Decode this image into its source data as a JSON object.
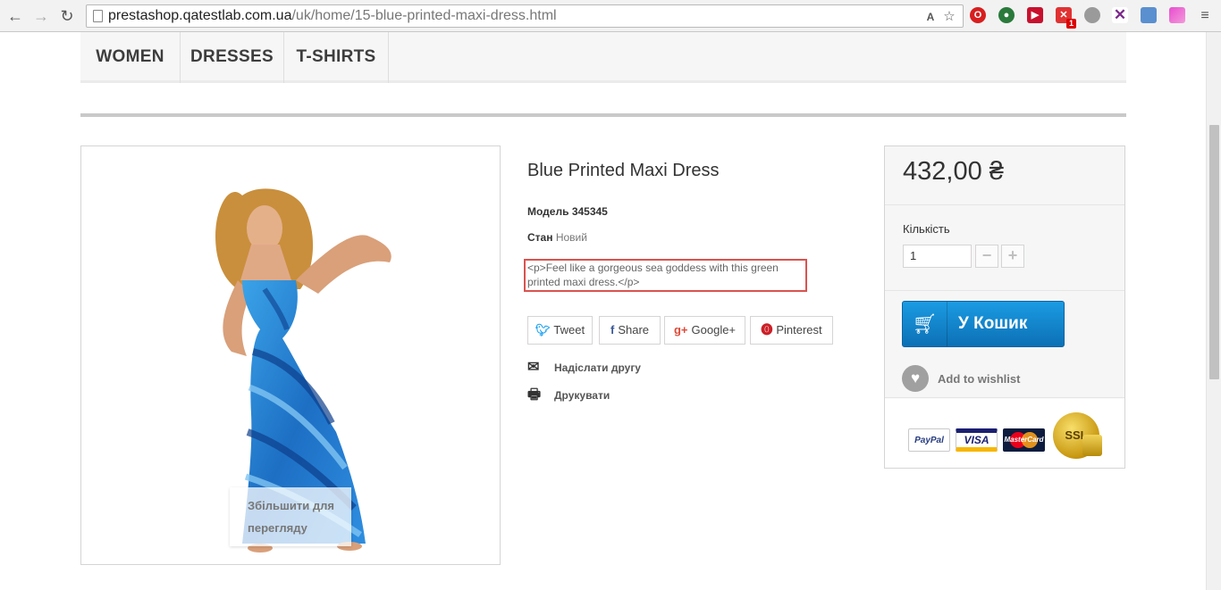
{
  "browser": {
    "url_host": "prestashop.qatestlab.com.ua",
    "url_path": "/uk/home/15-blue-printed-maxi-dress.html",
    "ext_badge": "1"
  },
  "menu": {
    "items": [
      "WOMEN",
      "DRESSES",
      "T-SHIRTS"
    ]
  },
  "image": {
    "zoom_hint_line1": "Збільшити для",
    "zoom_hint_line2": "перегляду"
  },
  "product": {
    "title": "Blue Printed Maxi Dress",
    "model_label": "Модель",
    "model_value": "345345",
    "condition_label": "Стан",
    "condition_value": "Новий",
    "description": "<p>Feel like a gorgeous sea goddess with this green printed maxi dress.</p>"
  },
  "share": {
    "tweet": "Tweet",
    "share": "Share",
    "google": "Google+",
    "pinterest": "Pinterest"
  },
  "actions": {
    "send_friend": "Надіслати другу",
    "print": "Друкувати"
  },
  "buy": {
    "price": "432,00 ₴",
    "qty_label": "Кількість",
    "qty_value": "1",
    "cart_label": "У Кошик",
    "wishlist_label": "Add to wishlist"
  },
  "payments": {
    "paypal": "PayPal",
    "visa": "VISA",
    "mastercard": "MasterCard",
    "ssl": "SSL"
  },
  "colors": {
    "accent": "#1b9be3",
    "highlight_border": "#d9534f",
    "dress": "#1f7fd1"
  }
}
